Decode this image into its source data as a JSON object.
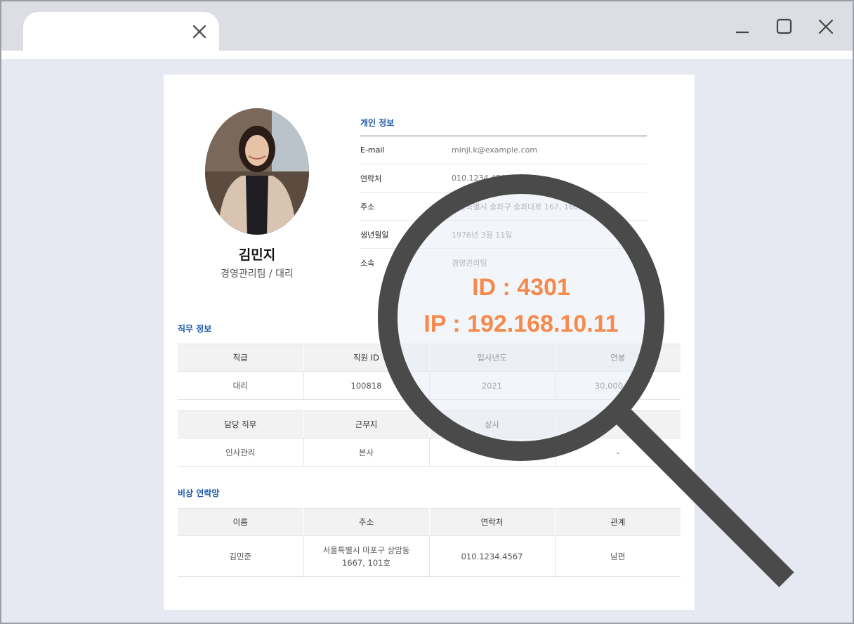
{
  "window": {
    "tab_close_icon": "close-icon",
    "controls": [
      "minimize-icon",
      "maximize-icon",
      "close-icon"
    ]
  },
  "profile": {
    "name": "김민지",
    "dept_position": "경영관리팀 / 대리"
  },
  "personal_info": {
    "title": "개인 정보",
    "rows": [
      {
        "key": "E-mail",
        "value": "minji.k@example.com"
      },
      {
        "key": "연락처",
        "value": "010.1234.4567"
      },
      {
        "key": "주소",
        "value": "서울특별시 송파구 송파대로 167, 1608호"
      },
      {
        "key": "생년월일",
        "value": "1976년 3월 11일"
      },
      {
        "key": "소속",
        "value": "경영관리팀"
      }
    ]
  },
  "job_info": {
    "title": "직무 정보",
    "table1": {
      "headers": [
        "직급",
        "직원 ID",
        "입사년도",
        "연봉"
      ],
      "row": [
        "대리",
        "100818",
        "2021",
        "30,000,000"
      ]
    },
    "table2": {
      "headers": [
        "담당 직무",
        "근무지",
        "상사",
        ""
      ],
      "row": [
        "인사관리",
        "본사",
        "",
        "-"
      ]
    }
  },
  "emergency": {
    "title": "비상 연락망",
    "headers": [
      "이름",
      "주소",
      "연락처",
      "관계"
    ],
    "row": {
      "name": "김민준",
      "address_line1": "서울특별시 마포구 상암동",
      "address_line2": "1667, 101호",
      "phone": "010.1234.4567",
      "relation": "남편"
    }
  },
  "lens": {
    "id_text": "ID : 4301",
    "ip_text": "IP : 192.168.10.11",
    "accent_color": "#f58a4c",
    "icon": "magnifier-icon"
  }
}
